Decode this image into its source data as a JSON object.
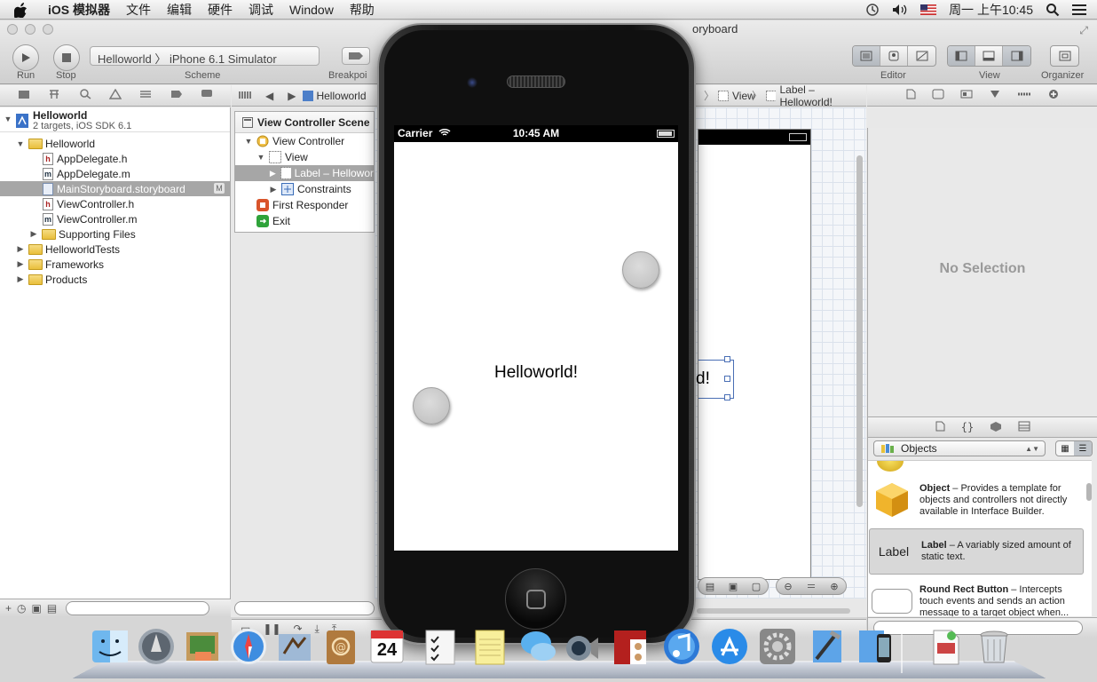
{
  "menubar": {
    "app": "iOS 模拟器",
    "items": [
      "文件",
      "编辑",
      "硬件",
      "调试",
      "Window",
      "帮助"
    ],
    "clock": "周一 上午10:45"
  },
  "window": {
    "title_fragment": "oryboard"
  },
  "toolbar": {
    "run_label": "Run",
    "stop_label": "Stop",
    "scheme_project": "Helloworld",
    "scheme_destination": "iPhone 6.1 Simulator",
    "scheme_label": "Scheme",
    "breakpoints_label": "Breakpoi",
    "editor_label": "Editor",
    "view_label": "View",
    "organizer_label": "Organizer"
  },
  "jumpbar": {
    "project": "Helloworld",
    "view": "View",
    "label": "Label – Helloworld!"
  },
  "navigator": {
    "project": {
      "name": "Helloworld",
      "subtitle": "2 targets, iOS SDK 6.1"
    },
    "group": "Helloworld",
    "files": [
      {
        "name": "AppDelegate.h",
        "kind": "h"
      },
      {
        "name": "AppDelegate.m",
        "kind": "m"
      },
      {
        "name": "MainStoryboard.storyboard",
        "kind": "sb",
        "badge": "M"
      },
      {
        "name": "ViewController.h",
        "kind": "h"
      },
      {
        "name": "ViewController.m",
        "kind": "m"
      }
    ],
    "supporting": "Supporting Files",
    "top_groups": [
      "HelloworldTests",
      "Frameworks",
      "Products"
    ]
  },
  "outline": {
    "scene": "View Controller Scene",
    "rows": [
      {
        "label": "View Controller"
      },
      {
        "label": "View"
      },
      {
        "label": "Label – Hellowor"
      },
      {
        "label": "Constraints"
      },
      {
        "label": "First Responder"
      },
      {
        "label": "Exit"
      }
    ]
  },
  "storyboard": {
    "label_fragment": "d!"
  },
  "simulator": {
    "carrier": "Carrier",
    "time": "10:45 AM",
    "label": "Helloworld!"
  },
  "utilities": {
    "no_selection": "No Selection",
    "library_select": "Objects",
    "items": [
      {
        "title": "Object",
        "desc": " – Provides a template for objects and controllers not directly available in Interface Builder."
      },
      {
        "title": "Label",
        "desc": " – A variably sized amount of static text.",
        "icon_text": "Label"
      },
      {
        "title": "Round Rect Button",
        "desc": " – Intercepts touch events and sends an action message to a target object when..."
      }
    ]
  },
  "dock": {
    "calendar_day": "24",
    "items": [
      "finder-icon",
      "launchpad-icon",
      "preview-icon",
      "safari-icon",
      "mail-icon",
      "contacts-icon",
      "calendar-icon",
      "reminders-icon",
      "notes-icon",
      "messages-icon",
      "facetime-icon",
      "photo-booth-icon",
      "itunes-icon",
      "app-store-icon",
      "system-preferences-icon",
      "xcode-icon",
      "ios-simulator-icon",
      "document-icon",
      "trash-icon"
    ]
  },
  "colors": {
    "selection_gray": "#a6a6a6",
    "canvas_grid": "#dbe2ec",
    "selection_blue": "#4a6fb5"
  }
}
